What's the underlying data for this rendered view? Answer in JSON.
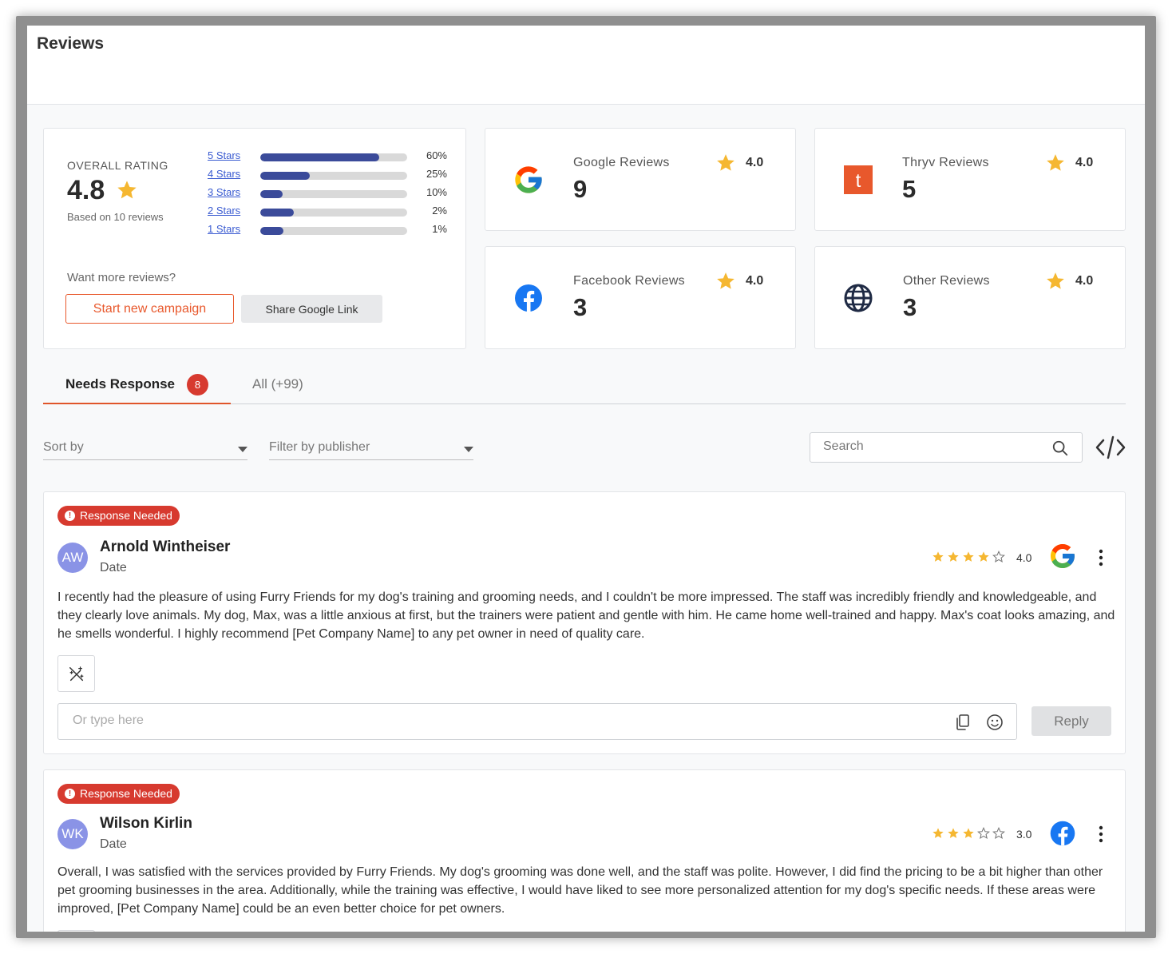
{
  "page": {
    "title": "Reviews"
  },
  "overall": {
    "label": "OVERALL RATING",
    "value": "4.8",
    "based_on": "Based on 10 reviews",
    "distribution": [
      {
        "label": "5 Stars",
        "percent": 60,
        "percent_label": "60%"
      },
      {
        "label": "4 Stars",
        "percent": 25,
        "percent_label": "25%"
      },
      {
        "label": "3 Stars",
        "percent": 10,
        "percent_label": "10%"
      },
      {
        "label": "2 Stars",
        "percent": 2,
        "percent_label": "2%"
      },
      {
        "label": "1 Stars",
        "percent": 1,
        "percent_label": "1%"
      }
    ],
    "more_reviews_label": "Want more reviews?",
    "campaign_button": "Start new campaign",
    "share_button": "Share Google Link"
  },
  "sources": [
    {
      "name": "Google Reviews",
      "count": "9",
      "rating": "4.0",
      "icon": "google-icon"
    },
    {
      "name": "Thryv Reviews",
      "count": "5",
      "rating": "4.0",
      "icon": "thryv-icon"
    },
    {
      "name": "Facebook Reviews",
      "count": "3",
      "rating": "4.0",
      "icon": "facebook-icon"
    },
    {
      "name": "Other Reviews",
      "count": "3",
      "rating": "4.0",
      "icon": "globe-icon"
    }
  ],
  "tabs": {
    "needs_response": {
      "label": "Needs Response",
      "badge": "8"
    },
    "all": {
      "label": "All (+99)"
    }
  },
  "filters": {
    "sort_by": "Sort by",
    "filter_publisher": "Filter by publisher",
    "search_placeholder": "Search"
  },
  "colors": {
    "accent": "#e8582c",
    "badge_red": "#d73a2f",
    "bar_fill": "#3b4b9a",
    "star": "#f5b731",
    "avatar": "#8a93e6"
  },
  "reviews": [
    {
      "badge": "Response Needed",
      "initials": "AW",
      "name": "Arnold Wintheiser",
      "date": "Date",
      "stars": 4,
      "rating": "4.0",
      "publisher": "google-icon",
      "text": "I recently had the pleasure of using Furry Friends for my dog's training and grooming needs, and I couldn't be more impressed. The staff was incredibly friendly and knowledgeable, and they clearly love animals. My dog, Max, was a little anxious at first, but the trainers were patient and gentle with him. He came home well-trained and happy.  Max's coat looks amazing, and he smells wonderful. I highly recommend [Pet Company Name] to any pet owner in need of quality care.",
      "reply_placeholder": "Or type here",
      "reply_button": "Reply"
    },
    {
      "badge": "Response Needed",
      "initials": "WK",
      "name": "Wilson Kirlin",
      "date": "Date",
      "stars": 3,
      "rating": "3.0",
      "publisher": "facebook-icon",
      "text": "Overall, I was satisfied with the services provided by Furry Friends. My dog's grooming was done well, and the staff was polite. However, I did find the pricing to be a bit higher than other pet grooming businesses in the area. Additionally, while the training was effective, I would have liked to see more personalized attention for my dog's specific needs. If these areas were improved, [Pet Company Name] could be an even better choice for pet owners."
    }
  ]
}
